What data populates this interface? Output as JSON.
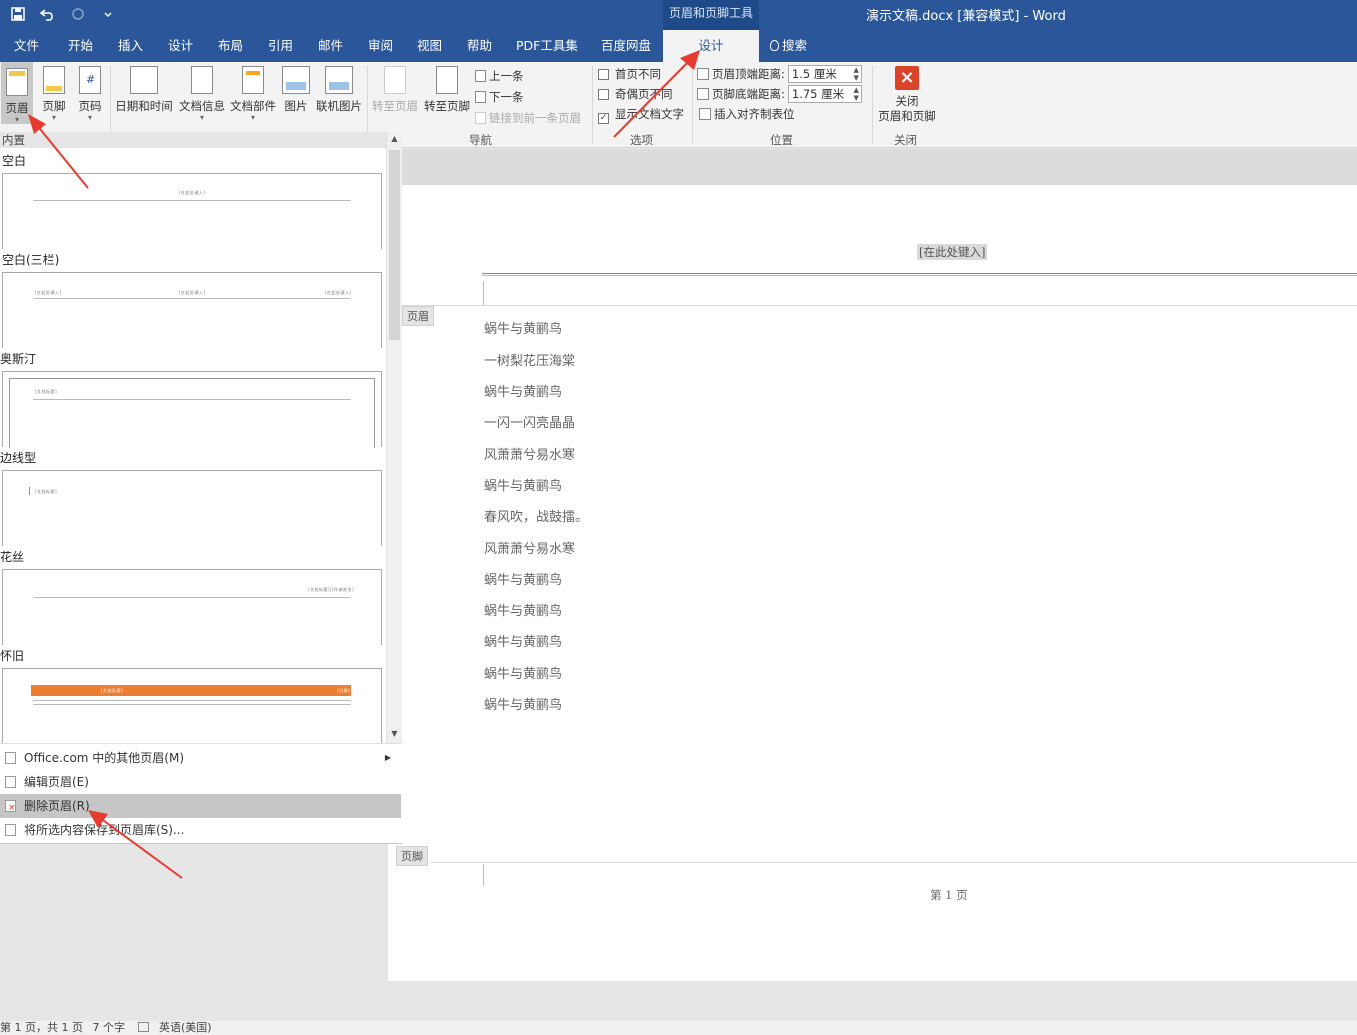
{
  "qat": {
    "save_icon": "save-icon",
    "undo_icon": "undo-icon",
    "redo_icon": "redo-icon",
    "customize_icon": "chevron-down-icon"
  },
  "context_tool": "页眉和页脚工具",
  "window_title": "演示文稿.docx [兼容模式]  -  Word",
  "tabs": [
    "文件",
    "开始",
    "插入",
    "设计",
    "布局",
    "引用",
    "邮件",
    "审阅",
    "视图",
    "帮助",
    "PDF工具集",
    "百度网盘",
    "设计",
    "搜索"
  ],
  "ribbon": {
    "insert_buttons": [
      "页眉",
      "页脚",
      "页码",
      "日期和时间",
      "文档信息",
      "文档部件",
      "图片",
      "联机图片"
    ],
    "nav_big": [
      "转至页眉",
      "转至页脚"
    ],
    "nav_small": [
      "上一条",
      "下一条",
      "链接到前一条页眉"
    ],
    "nav_label": "导航",
    "options": [
      {
        "label": "首页不同",
        "checked": false
      },
      {
        "label": "奇偶页不同",
        "checked": false
      },
      {
        "label": "显示文档文字",
        "checked": true
      }
    ],
    "options_label": "选项",
    "position": {
      "header_top_label": "页眉顶端距离:",
      "header_top_value": "1.5 厘米",
      "footer_bottom_label": "页脚底端距离:",
      "footer_bottom_value": "1.75 厘米",
      "insert_tab": "插入对齐制表位",
      "label": "位置"
    },
    "close": {
      "line1": "关闭",
      "line2": "页眉和页脚",
      "label": "关闭"
    }
  },
  "gallery": {
    "head": "内置",
    "sections": [
      {
        "title": "空白",
        "labels": [
          "[在此处键入]"
        ]
      },
      {
        "title": "空白(三栏)",
        "labels": [
          "[在此处键入]",
          "[在此处键入]",
          "[在此处键入]"
        ]
      },
      {
        "title": "奥斯汀",
        "labels": [
          "[文档标题]"
        ]
      },
      {
        "title": "边线型",
        "labels": [
          "[文档标题]"
        ]
      },
      {
        "title": "花丝",
        "labels": [
          "[文档标题]|[作者姓名]"
        ]
      },
      {
        "title": "怀旧",
        "labels": [
          "[文档标题]",
          "[日期]"
        ]
      }
    ],
    "menu": [
      "Office.com 中的其他页眉(M)",
      "编辑页眉(E)",
      "删除页眉(R)",
      "将所选内容保存到页眉库(S)..."
    ]
  },
  "document": {
    "header_placeholder": "[在此处键入]",
    "header_tag": "页眉",
    "footer_tag": "页脚",
    "lines": [
      "蜗牛与黄鹂鸟",
      "一树梨花压海棠",
      "蜗牛与黄鹂鸟",
      "一闪一闪亮晶晶",
      "风萧萧兮易水寒",
      "蜗牛与黄鹂鸟",
      "春风吹，战鼓擂。",
      "风萧萧兮易水寒",
      "蜗牛与黄鹂鸟",
      "蜗牛与黄鹂鸟",
      "蜗牛与黄鹂鸟",
      "蜗牛与黄鹂鸟",
      "蜗牛与黄鹂鸟"
    ],
    "footer_text": "第 1 页"
  },
  "statusbar": {
    "page": "第 1 页，共 1 页",
    "words": "7 个字",
    "language": "英语(美国)"
  },
  "colors": {
    "brand": "#2b579a",
    "close_red": "#d9442b",
    "arrow": "#e63b2e",
    "orange_band": "#ed7d31"
  }
}
